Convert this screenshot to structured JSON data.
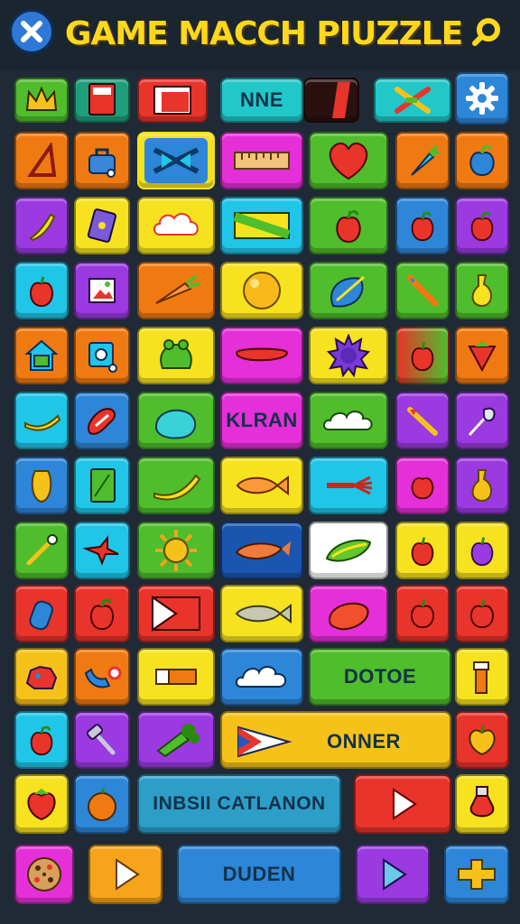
{
  "header": {
    "title": "GAME MACCH PIUZZLE",
    "close_icon": "close-icon",
    "search_icon": "search-icon"
  },
  "colors": {
    "background": "#1f2a36",
    "title": "#ffd81c",
    "red": "#e8342b",
    "orange": "#f07a12",
    "yellow": "#f6e21e",
    "green": "#4fbd2c",
    "cyan": "#1fc6e8",
    "blue": "#2d86d8",
    "magenta": "#e52fd8",
    "purple": "#9a3ae0"
  },
  "tiles": {
    "top_label": "NNE",
    "kraan": "KLRAN",
    "dotoe": "DOTOE",
    "onner": "ONNER",
    "msi": "INBSII CATLANON",
    "duden": "DUDEN"
  },
  "icons": [
    "crown-icon",
    "card-icon",
    "flag-icon",
    "bar-icon",
    "arrows-icon",
    "gear-icon",
    "triangle-icon",
    "bag-icon",
    "crossed-fish-icon",
    "ruler-icon",
    "heart-icon",
    "carrot-icon",
    "apple-icon",
    "banana-icon",
    "phone-icon",
    "cloud-icon",
    "bill-icon",
    "apple-icon",
    "apple-icon",
    "apple-icon",
    "apple-icon",
    "photo-icon",
    "carrot-icon",
    "orange-icon",
    "fish-icon",
    "pencil-icon",
    "pear-icon",
    "house-icon",
    "safe-icon",
    "frog-icon",
    "pepper-icon",
    "sun-icon",
    "apple-icon",
    "strawberry-icon",
    "banana-icon",
    "shoe-icon",
    "pear-icon",
    "cloud-icon",
    "pencil-icon",
    "feather-icon",
    "mango-icon",
    "tablet-icon",
    "banana-icon",
    "fish-icon",
    "fish-icon",
    "apple-icon",
    "pear-icon",
    "wand-icon",
    "starfish-icon",
    "sun-icon",
    "fish-icon",
    "cucumber-icon",
    "apple-icon",
    "apple-icon",
    "jar-icon",
    "apple-icon",
    "flag-icon",
    "fish-icon",
    "fruit-icon",
    "apple-icon",
    "apple-icon",
    "rock-icon",
    "shoe-icon",
    "brick-icon",
    "cloud-icon",
    "candle-icon",
    "apple-icon",
    "hammer-icon",
    "broccoli-icon",
    "flag-icon",
    "strawberry-icon",
    "strawberry-icon",
    "orange-icon",
    "play-icon",
    "potion-icon",
    "cookie-icon",
    "play-icon",
    "play-icon",
    "bone-icon"
  ]
}
